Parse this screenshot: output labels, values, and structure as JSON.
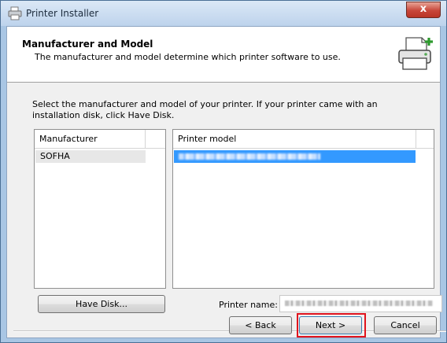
{
  "window": {
    "title": "Printer Installer",
    "close_label": "x"
  },
  "header": {
    "title": "Manufacturer and Model",
    "subtitle": "The manufacturer and model determine which printer software to use."
  },
  "instructions": "Select the manufacturer and model of your printer. If your printer came with an installation disk, click Have Disk.",
  "manufacturer_list": {
    "header": "Manufacturer",
    "items": [
      "SOFHA"
    ]
  },
  "model_list": {
    "header": "Printer model"
  },
  "buttons": {
    "have_disk": "Have Disk...",
    "back": "< Back",
    "next": "Next >",
    "cancel": "Cancel"
  },
  "printer_name": {
    "label": "Printer name:"
  }
}
